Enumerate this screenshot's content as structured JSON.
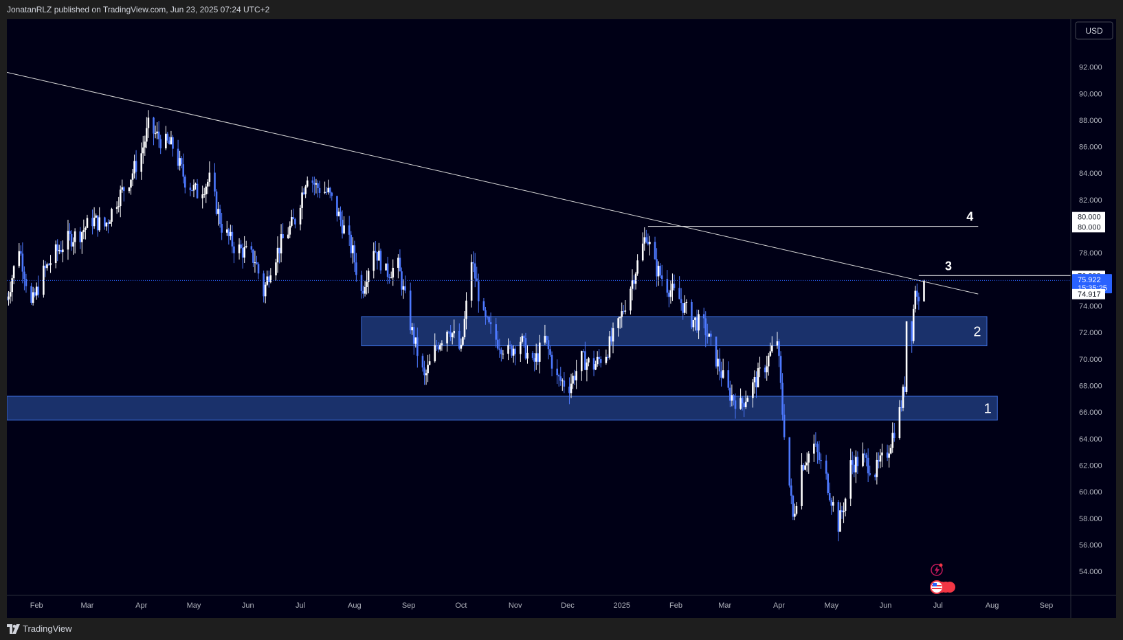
{
  "header": {
    "published_line": "JonatanRLZ published on TradingView.com, Jun 23, 2025 07:24 UTC+2"
  },
  "footer": {
    "brand": "TradingView"
  },
  "colors": {
    "background": "#000016",
    "up": "#ffffff",
    "down": "#4d79ff",
    "zone_fill": "#1e3a7a",
    "zone_border": "#3d6fe0",
    "price_tag": "#2962ff"
  },
  "chart_data": {
    "type": "candlestick",
    "currency_button": "USD",
    "y_range": [
      52.2,
      95.6
    ],
    "y_ticks": [
      "92.000",
      "90.000",
      "88.000",
      "86.000",
      "84.000",
      "82.000",
      "80.000",
      "78.000",
      "74.000",
      "72.000",
      "70.000",
      "68.000",
      "66.000",
      "64.000",
      "62.000",
      "60.000",
      "58.000",
      "56.000",
      "54.000"
    ],
    "x_range": [
      "2024-01-15",
      "2025-09-15"
    ],
    "x_ticks": [
      {
        "label": "Feb",
        "date": "2024-02-01"
      },
      {
        "label": "Mar",
        "date": "2024-03-01"
      },
      {
        "label": "Apr",
        "date": "2024-04-01"
      },
      {
        "label": "May",
        "date": "2024-05-01"
      },
      {
        "label": "Jun",
        "date": "2024-06-01"
      },
      {
        "label": "Jul",
        "date": "2024-07-01"
      },
      {
        "label": "Aug",
        "date": "2024-08-01"
      },
      {
        "label": "Sep",
        "date": "2024-09-01"
      },
      {
        "label": "Oct",
        "date": "2024-10-01"
      },
      {
        "label": "Nov",
        "date": "2024-11-01"
      },
      {
        "label": "Dec",
        "date": "2024-12-01"
      },
      {
        "label": "2025",
        "date": "2025-01-01"
      },
      {
        "label": "Feb",
        "date": "2025-02-01"
      },
      {
        "label": "Mar",
        "date": "2025-03-01"
      },
      {
        "label": "Apr",
        "date": "2025-04-01"
      },
      {
        "label": "May",
        "date": "2025-05-01"
      },
      {
        "label": "Jun",
        "date": "2025-06-01"
      },
      {
        "label": "Jul",
        "date": "2025-07-01"
      },
      {
        "label": "Aug",
        "date": "2025-08-01"
      },
      {
        "label": "Sep",
        "date": "2025-09-01"
      }
    ],
    "price_path": [
      [
        "2024-01-15",
        74.5
      ],
      [
        "2024-01-22",
        78.5
      ],
      [
        "2024-01-29",
        74.0
      ],
      [
        "2024-02-05",
        76.5
      ],
      [
        "2024-02-12",
        78.0
      ],
      [
        "2024-02-19",
        79.0
      ],
      [
        "2024-02-26",
        79.5
      ],
      [
        "2024-03-04",
        80.5
      ],
      [
        "2024-03-11",
        80.0
      ],
      [
        "2024-03-18",
        82.0
      ],
      [
        "2024-03-25",
        83.5
      ],
      [
        "2024-04-01",
        85.5
      ],
      [
        "2024-04-05",
        87.5
      ],
      [
        "2024-04-12",
        86.5
      ],
      [
        "2024-04-19",
        86.0
      ],
      [
        "2024-04-26",
        83.5
      ],
      [
        "2024-05-03",
        82.5
      ],
      [
        "2024-05-10",
        83.5
      ],
      [
        "2024-05-17",
        80.0
      ],
      [
        "2024-05-24",
        78.5
      ],
      [
        "2024-05-31",
        78.0
      ],
      [
        "2024-06-05",
        77.5
      ],
      [
        "2024-06-10",
        75.0
      ],
      [
        "2024-06-14",
        77.0
      ],
      [
        "2024-06-21",
        79.0
      ],
      [
        "2024-06-28",
        80.5
      ],
      [
        "2024-07-05",
        84.0
      ],
      [
        "2024-07-10",
        83.0
      ],
      [
        "2024-07-17",
        82.5
      ],
      [
        "2024-07-24",
        80.5
      ],
      [
        "2024-07-31",
        78.0
      ],
      [
        "2024-08-05",
        75.0
      ],
      [
        "2024-08-12",
        78.5
      ],
      [
        "2024-08-19",
        76.5
      ],
      [
        "2024-08-26",
        77.0
      ],
      [
        "2024-09-03",
        72.0
      ],
      [
        "2024-09-10",
        68.5
      ],
      [
        "2024-09-17",
        71.0
      ],
      [
        "2024-09-24",
        72.5
      ],
      [
        "2024-10-01",
        70.5
      ],
      [
        "2024-10-07",
        77.5
      ],
      [
        "2024-10-14",
        73.0
      ],
      [
        "2024-10-21",
        71.5
      ],
      [
        "2024-10-28",
        70.5
      ],
      [
        "2024-11-04",
        71.5
      ],
      [
        "2024-11-11",
        69.5
      ],
      [
        "2024-11-18",
        71.5
      ],
      [
        "2024-11-25",
        68.5
      ],
      [
        "2024-12-02",
        68.0
      ],
      [
        "2024-12-09",
        70.0
      ],
      [
        "2024-12-16",
        69.5
      ],
      [
        "2024-12-23",
        70.5
      ],
      [
        "2024-12-30",
        72.5
      ],
      [
        "2025-01-06",
        75.5
      ],
      [
        "2025-01-13",
        78.5
      ],
      [
        "2025-01-15",
        79.5
      ],
      [
        "2025-01-20",
        77.0
      ],
      [
        "2025-01-27",
        75.5
      ],
      [
        "2025-02-03",
        74.5
      ],
      [
        "2025-02-10",
        73.0
      ],
      [
        "2025-02-17",
        72.5
      ],
      [
        "2025-02-24",
        70.0
      ],
      [
        "2025-03-03",
        67.5
      ],
      [
        "2025-03-10",
        66.5
      ],
      [
        "2025-03-17",
        68.0
      ],
      [
        "2025-03-24",
        69.5
      ],
      [
        "2025-03-31",
        71.5
      ],
      [
        "2025-04-03",
        66.0
      ],
      [
        "2025-04-07",
        60.5
      ],
      [
        "2025-04-09",
        58.0
      ],
      [
        "2025-04-14",
        62.0
      ],
      [
        "2025-04-21",
        63.5
      ],
      [
        "2025-04-28",
        61.0
      ],
      [
        "2025-05-05",
        57.5
      ],
      [
        "2025-05-09",
        59.5
      ],
      [
        "2025-05-12",
        62.0
      ],
      [
        "2025-05-19",
        62.5
      ],
      [
        "2025-05-26",
        61.5
      ],
      [
        "2025-06-02",
        63.0
      ],
      [
        "2025-06-09",
        66.0
      ],
      [
        "2025-06-12",
        68.0
      ],
      [
        "2025-06-13",
        73.0
      ],
      [
        "2025-06-16",
        72.0
      ],
      [
        "2025-06-18",
        75.5
      ],
      [
        "2025-06-19",
        74.5
      ],
      [
        "2025-06-20",
        74.9
      ],
      [
        "2025-06-23",
        75.9
      ]
    ],
    "zones": [
      {
        "label": "2",
        "top": 73.2,
        "bottom": 71.0,
        "start": "2024-08-05",
        "end": "2025-07-29"
      },
      {
        "label": "1",
        "top": 67.2,
        "bottom": 65.4,
        "start": "2024-01-15",
        "end": "2025-08-04"
      }
    ],
    "trendline": {
      "start": [
        "2024-01-15",
        91.6
      ],
      "end": [
        "2025-07-24",
        74.9
      ]
    },
    "levels": [
      {
        "label": "4",
        "value": 80.0,
        "start": "2025-01-16",
        "end": "2025-07-24"
      },
      {
        "label": "3",
        "value": 76.292,
        "start": "2025-06-20",
        "end": "2025-09-15"
      }
    ],
    "dotted_price_line": 75.922,
    "price_tags": [
      {
        "text": "80.000",
        "value": 80.72,
        "kind": "white"
      },
      {
        "text": "80.000",
        "value": 79.96,
        "kind": "white"
      },
      {
        "text": "76.292",
        "value": 76.292,
        "kind": "white"
      },
      {
        "text": "75.922",
        "subtext": "15:35:25",
        "value": 75.73,
        "kind": "blue"
      },
      {
        "text": "74.917",
        "value": 74.917,
        "kind": "white"
      }
    ]
  }
}
